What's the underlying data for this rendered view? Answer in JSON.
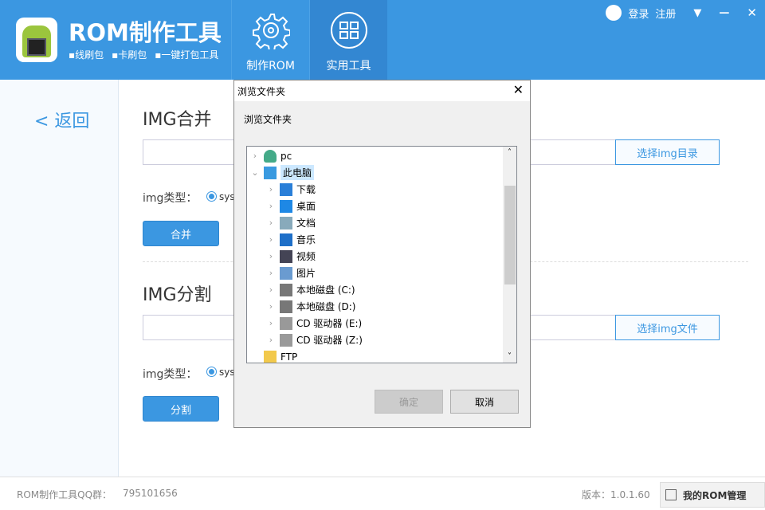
{
  "app": {
    "title": "ROM制作工具",
    "subtitles": [
      "▪线刷包",
      "▪卡刷包",
      "▪一键打包工具"
    ]
  },
  "nav": [
    {
      "label": "制作ROM",
      "icon": "gear-icon"
    },
    {
      "label": "实用工具",
      "icon": "grid-icon",
      "active": true
    }
  ],
  "topbar": {
    "login": "登录",
    "register": "注册"
  },
  "sidebar": {
    "back": "< 返回"
  },
  "merge": {
    "title": "IMG合并",
    "select": "选择img目录",
    "type_label": "img类型：",
    "radio": "syst",
    "button": "合并"
  },
  "split": {
    "title": "IMG分割",
    "select": "选择img文件",
    "type_label": "img类型：",
    "radio": "syst",
    "button": "分割"
  },
  "footer": {
    "qq_label": "ROM制作工具QQ群：",
    "qq": "795101656",
    "version": "版本：1.0.1.60",
    "my_rom": "我的ROM管理"
  },
  "dialog": {
    "title": "浏览文件夹",
    "prompt": "浏览文件夹",
    "ok": "确定",
    "cancel": "取消",
    "tree": [
      {
        "label": "pc",
        "icon": "user-icon",
        "level": 0,
        "expanded": false
      },
      {
        "label": "此电脑",
        "icon": "computer-icon",
        "level": 0,
        "expanded": true,
        "selected": true
      },
      {
        "label": "下载",
        "icon": "download-icon",
        "level": 1
      },
      {
        "label": "桌面",
        "icon": "desktop-icon",
        "level": 1
      },
      {
        "label": "文档",
        "icon": "document-icon",
        "level": 1
      },
      {
        "label": "音乐",
        "icon": "music-icon",
        "level": 1
      },
      {
        "label": "视频",
        "icon": "video-icon",
        "level": 1
      },
      {
        "label": "图片",
        "icon": "picture-icon",
        "level": 1
      },
      {
        "label": "本地磁盘 (C:)",
        "icon": "drive-icon",
        "level": 1
      },
      {
        "label": "本地磁盘 (D:)",
        "icon": "drive-icon",
        "level": 1
      },
      {
        "label": "CD 驱动器 (E:)",
        "icon": "cd-drive-icon",
        "level": 1
      },
      {
        "label": "CD 驱动器 (Z:)",
        "icon": "cd-drive-icon",
        "level": 1
      },
      {
        "label": "FTP",
        "icon": "folder-icon",
        "level": 0,
        "nochev": true
      }
    ]
  },
  "colors": {
    "brand": "#3b97e1",
    "active_tab": "#3387d2"
  }
}
